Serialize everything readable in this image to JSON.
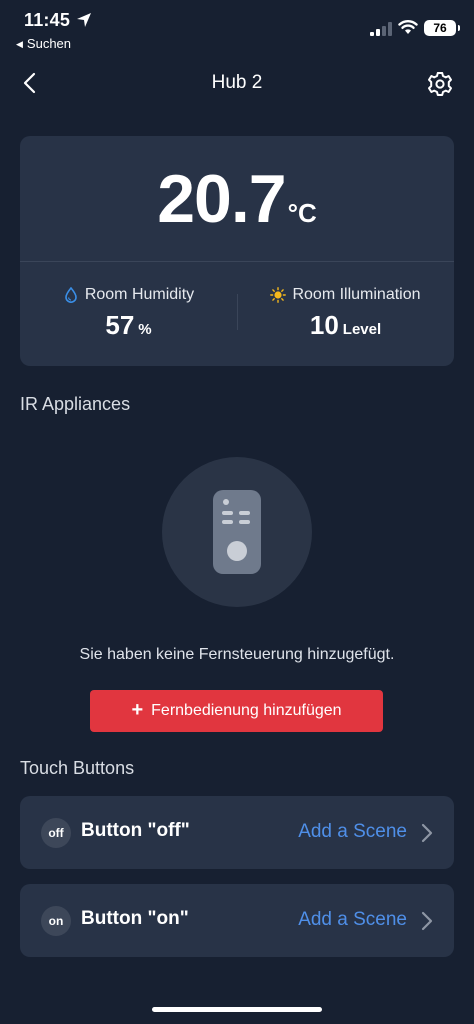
{
  "status": {
    "time": "11:45",
    "back_app": "Suchen",
    "battery": "76"
  },
  "nav": {
    "title": "Hub 2"
  },
  "climate": {
    "temperature": "20.7",
    "temperature_unit": "°C",
    "humidity_label": "Room Humidity",
    "humidity_value": "57",
    "humidity_unit": "%",
    "illumination_label": "Room Illumination",
    "illumination_value": "10",
    "illumination_unit": "Level"
  },
  "ir_section": {
    "title": "IR Appliances",
    "empty_message": "Sie haben keine Fernsteuerung hinzugefügt.",
    "add_button_label": "Fernbedienung hinzufügen"
  },
  "touch_section": {
    "title": "Touch Buttons",
    "items": [
      {
        "badge": "off",
        "name": "Button \"off\"",
        "action": "Add a Scene"
      },
      {
        "badge": "on",
        "name": "Button \"on\"",
        "action": "Add a Scene"
      }
    ]
  },
  "colors": {
    "background": "#172031",
    "card": "#283347",
    "accent_red": "#e1363f",
    "link_blue": "#4f8fe8",
    "humidity_icon": "#3a8ee6",
    "sun_icon": "#f5b81c"
  },
  "icons": {
    "location": "location-arrow-icon",
    "signal": "cellular-signal-icon",
    "wifi": "wifi-icon",
    "back": "chevron-left-icon",
    "settings": "gear-icon",
    "humidity": "water-drop-icon",
    "illumination": "sun-icon",
    "remote": "remote-control-icon",
    "chevron": "chevron-right-icon"
  }
}
